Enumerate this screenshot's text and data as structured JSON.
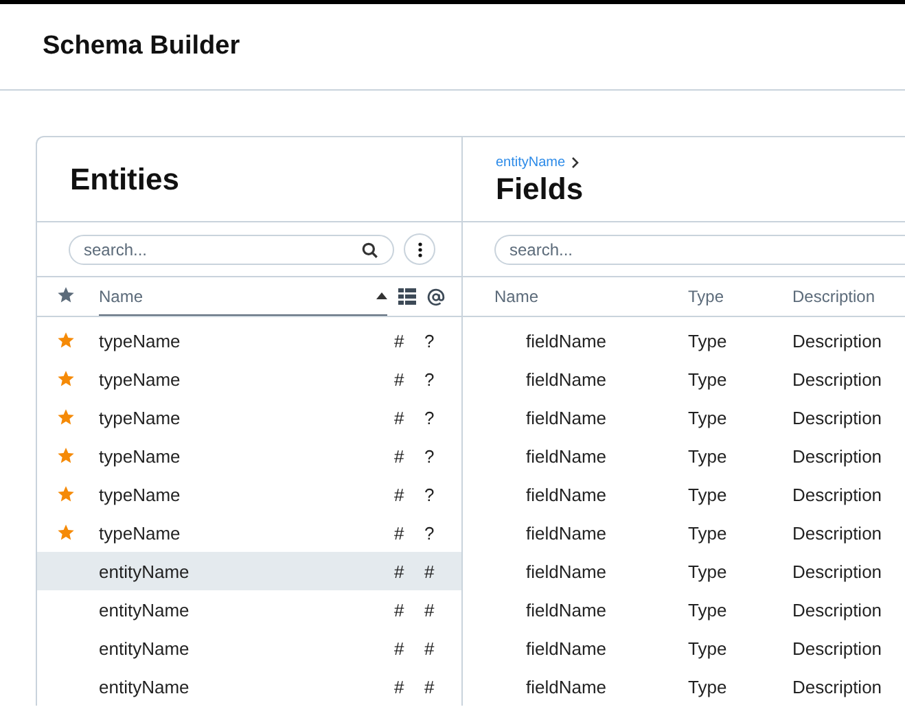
{
  "header": {
    "title": "Schema Builder"
  },
  "entities": {
    "title": "Entities",
    "search": {
      "placeholder": "search..."
    },
    "columns": [
      {
        "label": "Name",
        "sorted": true
      }
    ],
    "rows": [
      {
        "name": "typeName",
        "starred": true,
        "selected": false,
        "column_3": "#",
        "column_4": "?"
      },
      {
        "name": "typeName",
        "starred": true,
        "selected": false,
        "column_3": "#",
        "column_4": "?"
      },
      {
        "name": "typeName",
        "starred": true,
        "selected": false,
        "column_3": "#",
        "column_4": "?"
      },
      {
        "name": "typeName",
        "starred": true,
        "selected": false,
        "column_3": "#",
        "column_4": "?"
      },
      {
        "name": "typeName",
        "starred": true,
        "selected": false,
        "column_3": "#",
        "column_4": "?"
      },
      {
        "name": "typeName",
        "starred": true,
        "selected": false,
        "column_3": "#",
        "column_4": "?"
      },
      {
        "name": "entityName",
        "starred": false,
        "selected": true,
        "column_3": "#",
        "column_4": "#"
      },
      {
        "name": "entityName",
        "starred": false,
        "selected": false,
        "column_3": "#",
        "column_4": "#"
      },
      {
        "name": "entityName",
        "starred": false,
        "selected": false,
        "column_3": "#",
        "column_4": "#"
      },
      {
        "name": "entityName",
        "starred": false,
        "selected": false,
        "column_3": "#",
        "column_4": "#"
      }
    ]
  },
  "fields": {
    "breadcrumb": "entityName",
    "title": "Fields",
    "search": {
      "placeholder": "search..."
    },
    "columns": [
      "Name",
      "Type",
      "Description"
    ],
    "rows": [
      {
        "name": "fieldName",
        "type": "Type",
        "description": "Description"
      },
      {
        "name": "fieldName",
        "type": "Type",
        "description": "Description"
      },
      {
        "name": "fieldName",
        "type": "Type",
        "description": "Description"
      },
      {
        "name": "fieldName",
        "type": "Type",
        "description": "Description"
      },
      {
        "name": "fieldName",
        "type": "Type",
        "description": "Description"
      },
      {
        "name": "fieldName",
        "type": "Type",
        "description": "Description"
      },
      {
        "name": "fieldName",
        "type": "Type",
        "description": "Description"
      },
      {
        "name": "fieldName",
        "type": "Type",
        "description": "Description"
      },
      {
        "name": "fieldName",
        "type": "Type",
        "description": "Description"
      },
      {
        "name": "fieldName",
        "type": "Type",
        "description": "Description"
      }
    ]
  }
}
